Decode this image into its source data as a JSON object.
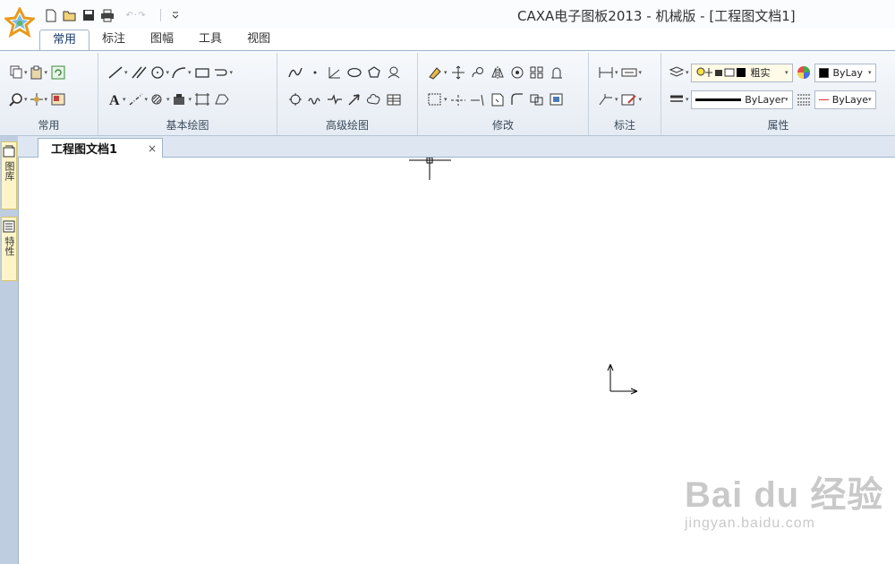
{
  "window": {
    "title": "CAXA电子图板2013 - 机械版 - [工程图文档1]"
  },
  "menu_tabs": [
    "常用",
    "标注",
    "图幅",
    "工具",
    "视图"
  ],
  "ribbon": {
    "groups": [
      "常用",
      "基本绘图",
      "高级绘图",
      "修改",
      "标注",
      "属性"
    ],
    "layer_value": "粗实",
    "color_value": "ByLay",
    "linetype_value": "ByLayer",
    "lineweight_value": "ByLaye"
  },
  "document": {
    "tab_label": "工程图文档1",
    "close_label": "×"
  },
  "side_panels": [
    "图库",
    "特性"
  ],
  "watermark": {
    "main": "Bai du 经验",
    "sub": "jingyan.baidu.com"
  },
  "colors": {
    "accent": "#1b3c6e",
    "ribbon_border": "#9fb3cc",
    "side_tab": "#fdf5c9"
  }
}
